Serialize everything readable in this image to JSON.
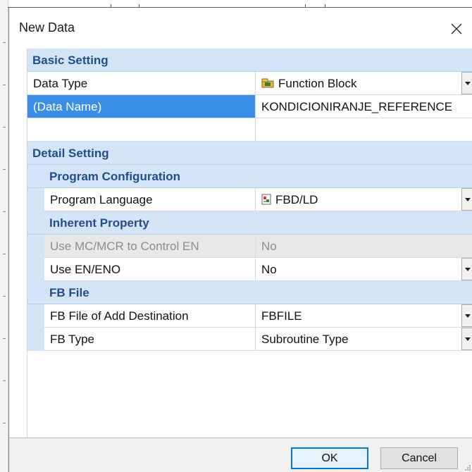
{
  "dialog": {
    "title": "New Data",
    "close_icon": "close-icon"
  },
  "basic_setting": {
    "label": "Basic Setting",
    "rows": [
      {
        "name": "Data Type",
        "value": "Function Block",
        "icon": "function-block-icon",
        "dropdown": true
      },
      {
        "name": "(Data Name)",
        "value": "KONDICIONIRANJE_REFERENCE",
        "selected": true
      },
      {
        "name": "",
        "value": ""
      }
    ]
  },
  "detail_setting": {
    "label": "Detail Setting",
    "program_configuration": {
      "label": "Program Configuration",
      "rows": [
        {
          "name": "Program Language",
          "value": "FBD/LD",
          "icon": "fbd-ld-icon",
          "dropdown": true
        }
      ]
    },
    "inherent_property": {
      "label": "Inherent Property",
      "rows": [
        {
          "name": "Use MC/MCR to Control EN",
          "value": "No",
          "disabled": true
        },
        {
          "name": "Use EN/ENO",
          "value": "No",
          "dropdown": true
        }
      ]
    },
    "fb_file": {
      "label": "FB File",
      "rows": [
        {
          "name": "FB File of Add Destination",
          "value": "FBFILE",
          "dropdown": true
        },
        {
          "name": "FB Type",
          "value": "Subroutine Type",
          "dropdown": true
        }
      ]
    }
  },
  "footer": {
    "ok_label": "OK",
    "cancel_label": "Cancel"
  },
  "colors": {
    "category_bg": "#d4e4f7",
    "category_text": "#1f4e8c",
    "selected_bg": "#3a8ee6",
    "disabled_bg": "#e8e8e8"
  }
}
